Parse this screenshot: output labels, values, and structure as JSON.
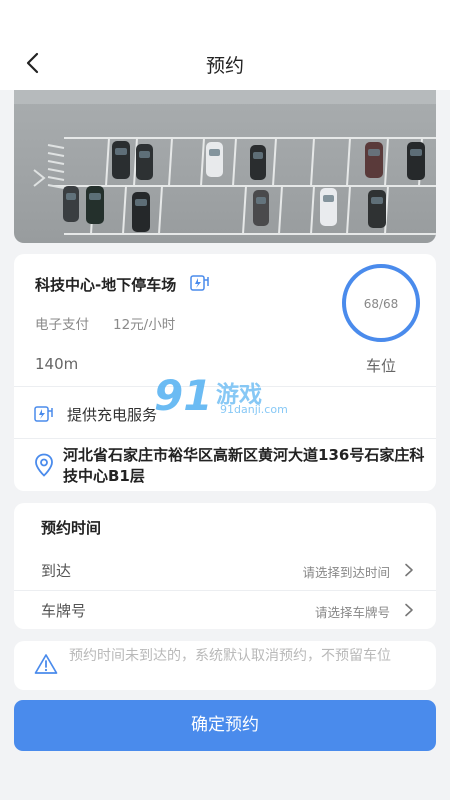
{
  "header": {
    "title": "预约",
    "back_icon": "chevron-left-icon"
  },
  "lot": {
    "name": "科技中心-地下停车场",
    "payment": "电子支付",
    "price": "12元/小时",
    "distance": "140m",
    "availability": "68/68",
    "availability_ratio": 1.0,
    "spaces_label": "车位",
    "charging_service": "提供充电服务",
    "address": "河北省石家庄市裕华区高新区黄河大道136号石家庄科技中心B1层"
  },
  "reservation": {
    "section_title": "预约时间",
    "rows": [
      {
        "label": "到达",
        "hint": "请选择到达时间"
      },
      {
        "label": "车牌号",
        "hint": "请选择车牌号"
      }
    ]
  },
  "notice": "预约时间未到达的，系统默认取消预约，不预留车位",
  "confirm_label": "确定预约",
  "watermark": {
    "logo": "91",
    "name": "游戏",
    "url": "91danji.com"
  },
  "colors": {
    "accent": "#4a8bec",
    "ring": "#4a8bec",
    "background": "#f2f3f5"
  }
}
